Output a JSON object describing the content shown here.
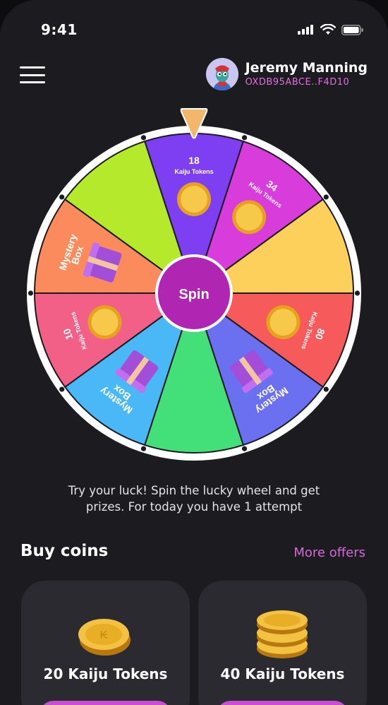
{
  "status": {
    "time": "9:41"
  },
  "header": {
    "user_name": "Jeremy Manning",
    "wallet": "OXDB95ABCE..F4D10"
  },
  "wheel": {
    "center_label": "Spin",
    "segments": [
      {
        "color": "#7e3ff2",
        "value": "18",
        "label": "Kaiju Tokens",
        "prize": "coin"
      },
      {
        "color": "#d83ddb",
        "value": "34",
        "label": "Kaiju Tokens",
        "prize": "coin"
      },
      {
        "color": "#fdd05b",
        "value": "",
        "label": "",
        "prize": "none"
      },
      {
        "color": "#f75a5a",
        "value": "80",
        "label": "Kaiju Tokens",
        "prize": "coin"
      },
      {
        "color": "#6a70f0",
        "value": "Box",
        "label": "Mystery",
        "prize": "gift"
      },
      {
        "color": "#43e07a",
        "value": "",
        "label": "",
        "prize": "none"
      },
      {
        "color": "#4ab8f7",
        "value": "Box",
        "label": "Mystery",
        "prize": "gift"
      },
      {
        "color": "#f25f87",
        "value": "10",
        "label": "Kaiju Tokens",
        "prize": "coin"
      },
      {
        "color": "#fb8b5c",
        "value": "Box",
        "label": "Mystery",
        "prize": "gift"
      },
      {
        "color": "#b5ea2c",
        "value": "",
        "label": "",
        "prize": "none"
      }
    ]
  },
  "tagline_line1": "Try your luck! Spin the lucky wheel and get",
  "tagline_line2": "prizes. For today you have 1 attempt",
  "buy": {
    "title": "Buy coins",
    "more_label": "More offers",
    "cards": [
      {
        "title": "20 Kaiju Tokens"
      },
      {
        "title": "40 Kaiju Tokens"
      }
    ]
  },
  "colors": {
    "accent": "#d46ad8",
    "background": "#1c1b20",
    "card": "#2b2a31"
  }
}
